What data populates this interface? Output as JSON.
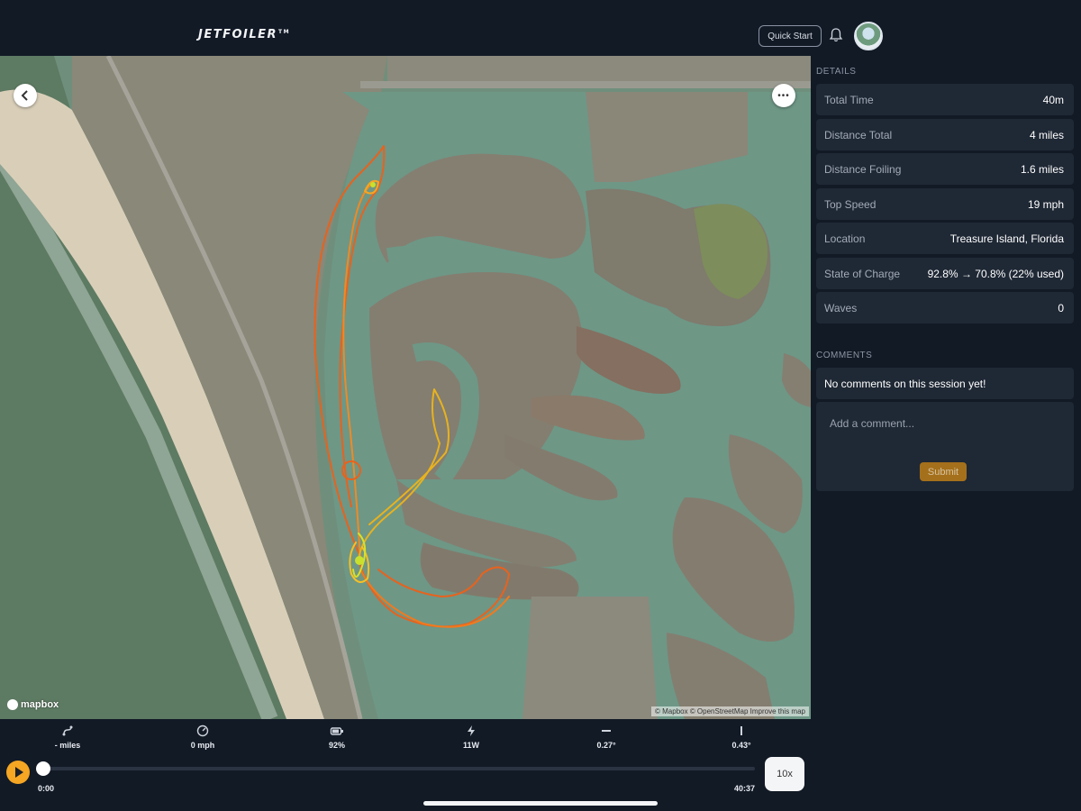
{
  "header": {
    "logo": "JETFOILER",
    "logo_mark": "TM",
    "quick_start_label": "Quick Start"
  },
  "map": {
    "provider": "mapbox",
    "attribution": "© Mapbox © OpenStreetMap  Improve this map"
  },
  "details": {
    "title": "DETAILS",
    "rows": [
      {
        "label": "Total Time",
        "value": "40m"
      },
      {
        "label": "Distance Total",
        "value": "4 miles"
      },
      {
        "label": "Distance Foiling",
        "value": "1.6 miles"
      },
      {
        "label": "Top Speed",
        "value": "19 mph"
      },
      {
        "label": "Location",
        "value": "Treasure Island, Florida"
      },
      {
        "label": "State of Charge",
        "value": "92.8% → 70.8% (22% used)"
      },
      {
        "label": "Waves",
        "value": "0"
      }
    ]
  },
  "comments": {
    "title": "COMMENTS",
    "empty_text": "No comments on this session yet!",
    "placeholder": "Add a comment...",
    "submit_label": "Submit"
  },
  "playback": {
    "stats": [
      {
        "icon": "distance-icon",
        "value": "- miles"
      },
      {
        "icon": "speedometer-icon",
        "value": "0 mph"
      },
      {
        "icon": "battery-icon",
        "value": "92%"
      },
      {
        "icon": "lightning-icon",
        "value": "11W"
      },
      {
        "icon": "roll-icon",
        "value": "0.27°"
      },
      {
        "icon": "pitch-icon",
        "value": "0.43°"
      }
    ],
    "time_start": "0:00",
    "time_end": "40:37",
    "speed_label": "10x",
    "progress": 0
  },
  "colors": {
    "accent": "#f5a623",
    "background": "#121a26",
    "card": "#1f2835",
    "track_slow": "#f07a1e",
    "track_fast": "#c9e02c"
  }
}
